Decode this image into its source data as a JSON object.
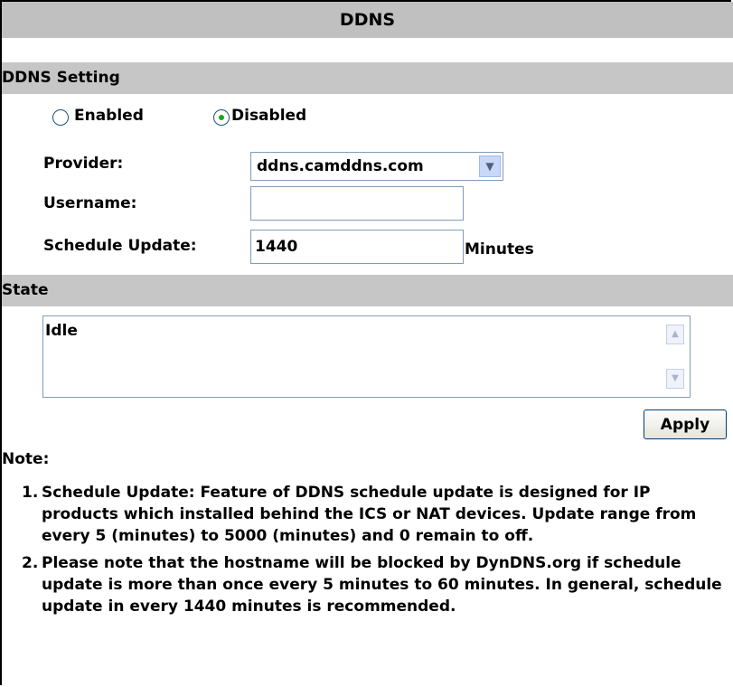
{
  "page": {
    "title": "DDNS"
  },
  "ddns_setting": {
    "header": "DDNS Setting",
    "enabled_label": "Enabled",
    "disabled_label": "Disabled",
    "selected": "Disabled",
    "provider_label": "Provider:",
    "provider_value": "ddns.camddns.com",
    "username_label": "Username:",
    "username_value": "",
    "schedule_label": "Schedule Update:",
    "schedule_value": "1440",
    "schedule_unit": "Minutes"
  },
  "state": {
    "header": "State",
    "value": "Idle"
  },
  "apply_label": "Apply",
  "note": {
    "title": "Note:",
    "items": [
      {
        "num": "1.",
        "text": "Schedule Update: Feature of DDNS schedule update is designed for IP products which installed behind the ICS or NAT devices. Update range from every 5 (minutes) to 5000 (minutes) and 0 remain to off."
      },
      {
        "num": "2.",
        "text": "Please note that the hostname will be blocked by DynDNS.org if schedule update is more than once every 5 minutes to 60 minutes. In general, schedule update in every 1440 minutes is recommended."
      }
    ]
  }
}
